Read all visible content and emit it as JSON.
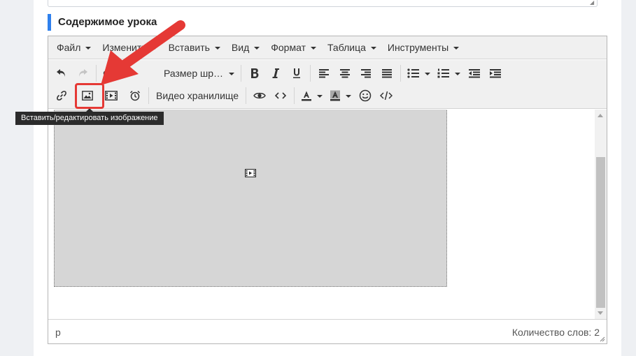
{
  "section_title": "Содержимое урока",
  "menubar": [
    {
      "label": "Файл"
    },
    {
      "label": "Изменить"
    },
    {
      "label": "Вставить"
    },
    {
      "label": "Вид"
    },
    {
      "label": "Формат"
    },
    {
      "label": "Таблица"
    },
    {
      "label": "Инструменты"
    }
  ],
  "toolbar": {
    "font_family_label": "Ф",
    "font_size_label": "Размер шр…",
    "video_storage_label": "Видео хранилище"
  },
  "tooltip": "Вставить/редактировать изображение",
  "statusbar": {
    "path": "p",
    "word_count": "Количество слов: 2"
  },
  "icons": {
    "undo": "undo-icon",
    "redo": "redo-icon",
    "bold": "bold-icon",
    "italic": "italic-icon",
    "underline": "underline-icon",
    "align_left": "align-left-icon",
    "align_center": "align-center-icon",
    "align_right": "align-right-icon",
    "justify": "align-justify-icon",
    "bullet_list": "bullet-list-icon",
    "numbered_list": "numbered-list-icon",
    "outdent": "outdent-icon",
    "indent": "indent-icon",
    "link": "link-icon",
    "image": "image-icon",
    "media": "media-icon",
    "alarm": "alarm-clock-icon",
    "preview": "eye-icon",
    "code": "code-icon",
    "text_color": "text-color-icon",
    "background_color": "background-color-icon",
    "emoticons": "smiley-icon",
    "source_code": "source-code-icon"
  },
  "colors": {
    "accent": "#2f80ed",
    "annotation": "#e53935",
    "tooltip_bg": "#2b2b2b",
    "toolbar_bg": "#f0f0f0"
  }
}
